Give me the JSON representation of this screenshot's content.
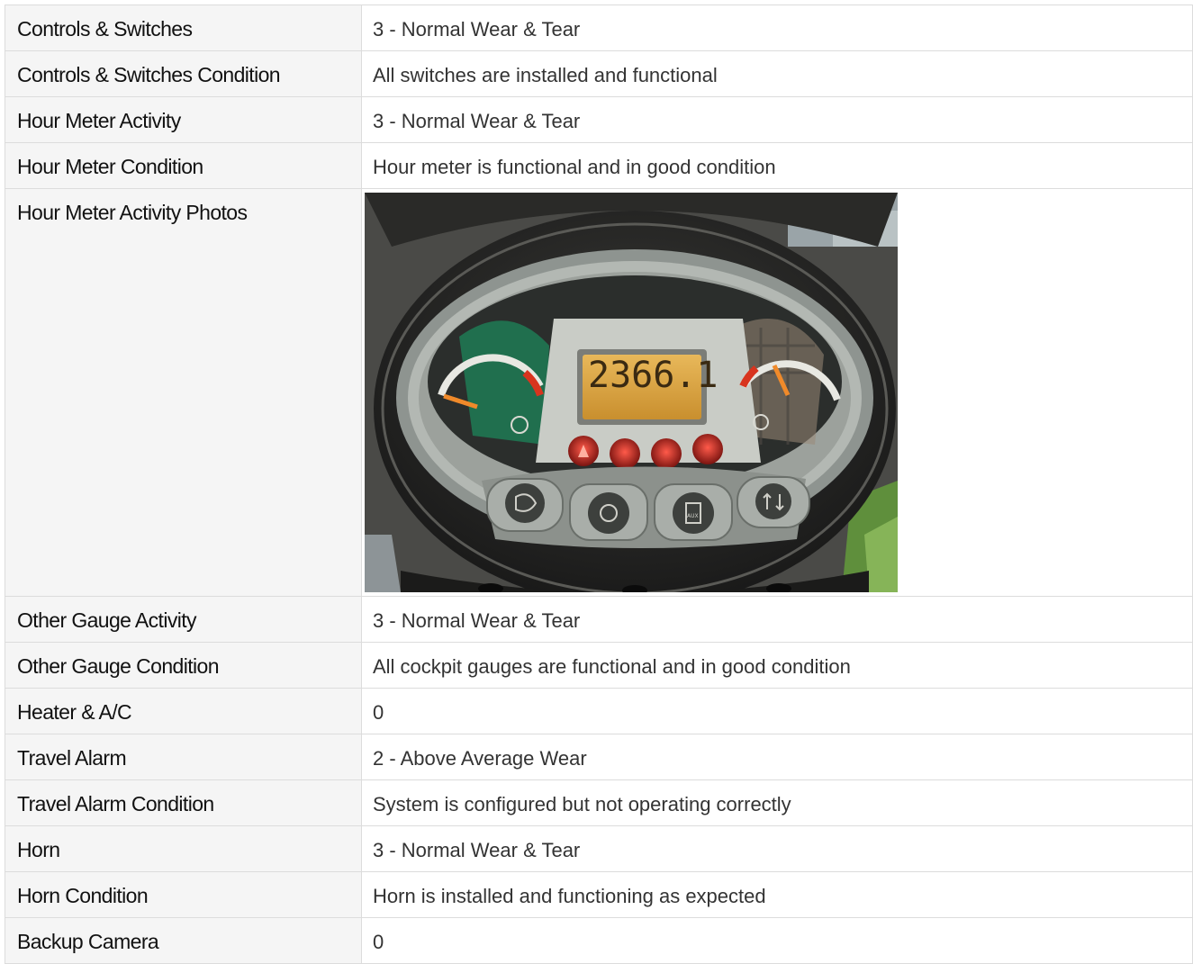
{
  "rows": [
    {
      "label": "Controls & Switches",
      "value": "3 - Normal Wear & Tear"
    },
    {
      "label": "Controls & Switches Condition",
      "value": "All switches are installed and functional"
    },
    {
      "label": "Hour Meter Activity",
      "value": "3 - Normal Wear & Tear"
    },
    {
      "label": "Hour Meter Condition",
      "value": "Hour meter is functional and in good condition"
    },
    {
      "label": "Hour Meter Activity Photos",
      "value": ""
    },
    {
      "label": "Other Gauge Activity",
      "value": "3 - Normal Wear & Tear"
    },
    {
      "label": "Other Gauge Condition",
      "value": "All cockpit gauges are functional and in good condition"
    },
    {
      "label": "Heater & A/C",
      "value": "0"
    },
    {
      "label": "Travel Alarm",
      "value": "2 - Above Average Wear"
    },
    {
      "label": "Travel Alarm Condition",
      "value": "System is configured but not operating correctly"
    },
    {
      "label": "Horn",
      "value": "3 - Normal Wear & Tear"
    },
    {
      "label": "Horn Condition",
      "value": "Horn is installed and functioning as expected"
    },
    {
      "label": "Backup Camera",
      "value": "0"
    }
  ],
  "photo": {
    "hour_meter_reading": "2366.1",
    "aux_label": "AUX"
  }
}
